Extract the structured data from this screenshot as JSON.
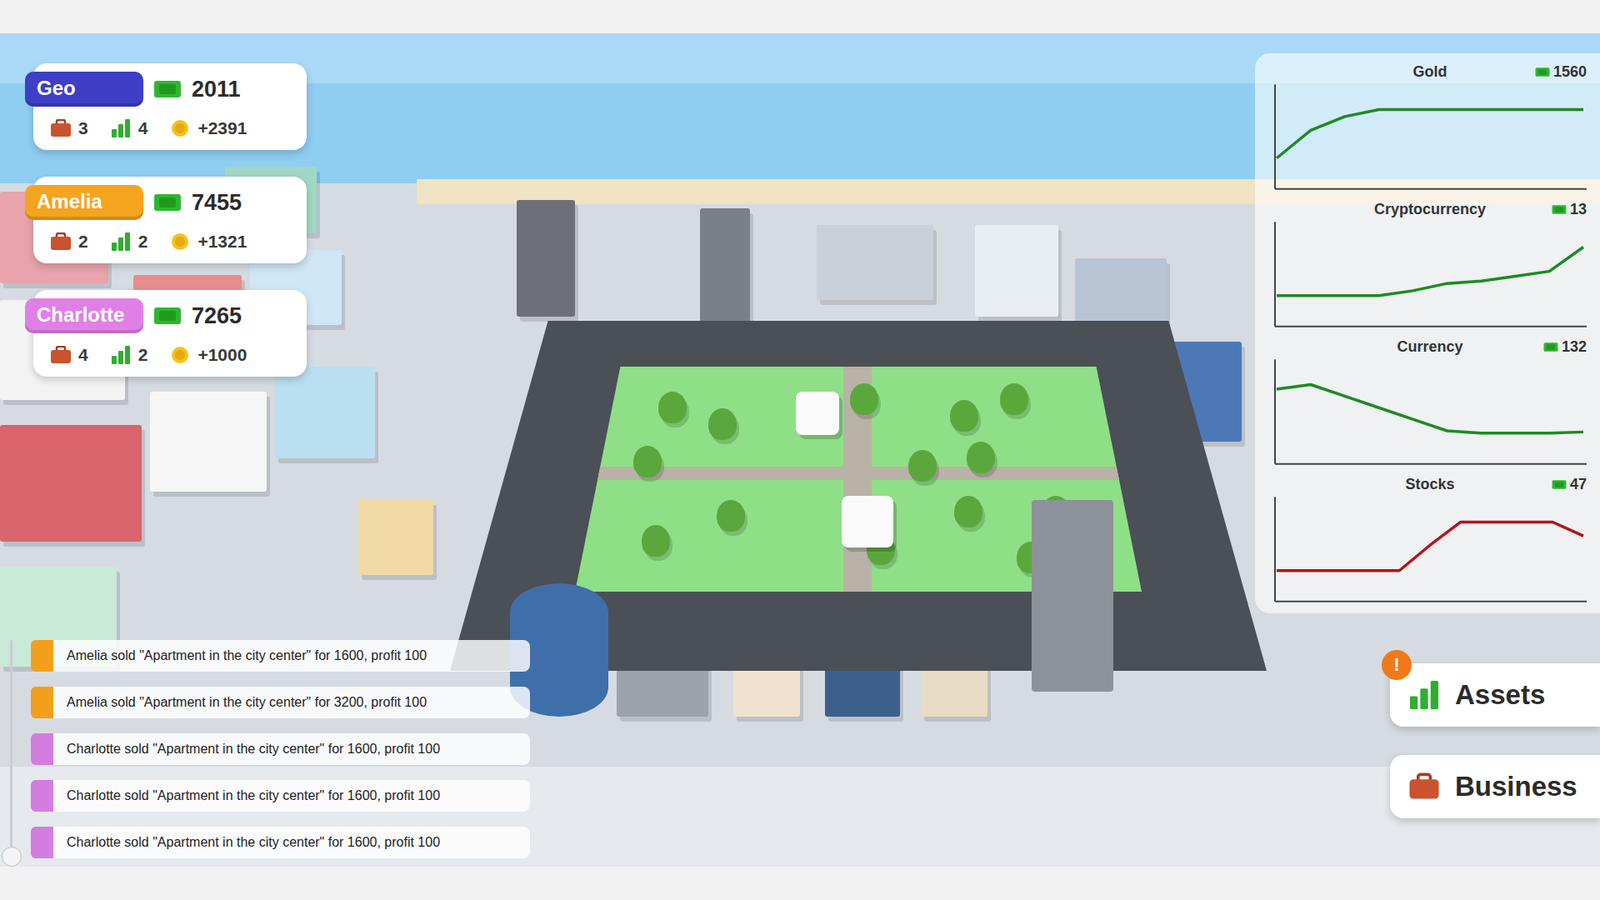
{
  "players": [
    {
      "name": "Geo",
      "color": "#3d3fc6",
      "money": "2011",
      "businesses": "3",
      "assets": "4",
      "income": "+2391"
    },
    {
      "name": "Amelia",
      "color": "#f4a41e",
      "money": "7455",
      "businesses": "2",
      "assets": "2",
      "income": "+1321"
    },
    {
      "name": "Charlotte",
      "color": "#e080e6",
      "money": "7265",
      "businesses": "4",
      "assets": "2",
      "income": "+1000"
    }
  ],
  "markets": [
    {
      "title": "Gold",
      "price": "1560",
      "color": "#1f8a22",
      "values": [
        1420,
        1500,
        1540,
        1560,
        1560,
        1560,
        1560,
        1560,
        1560,
        1560
      ]
    },
    {
      "title": "Cryptocurrency",
      "price": "13",
      "color": "#1f8a22",
      "values": [
        9,
        9,
        9,
        9,
        9.2,
        9.5,
        9.6,
        9.8,
        10,
        11
      ]
    },
    {
      "title": "Currency",
      "price": "132",
      "color": "#1f8a22",
      "values": [
        178,
        182,
        172,
        162,
        152,
        142,
        140,
        140,
        140,
        141
      ]
    },
    {
      "title": "Stocks",
      "price": "47",
      "color": "#b3141b",
      "values": [
        20,
        20,
        20,
        20,
        20,
        42,
        62,
        62,
        62,
        62,
        50
      ]
    }
  ],
  "log": [
    {
      "text": "Amelia sold \"Apartment in the city center\" for 1600, profit 100",
      "color": "#f2a01c"
    },
    {
      "text": "Amelia sold \"Apartment in the city center\" for 3200, profit 100",
      "color": "#f2a01c"
    },
    {
      "text": "Charlotte sold \"Apartment in the city center\" for 1600, profit 100",
      "color": "#d47de0"
    },
    {
      "text": "Charlotte sold \"Apartment in the city center\" for 1600, profit 100",
      "color": "#d47de0"
    },
    {
      "text": "Charlotte sold \"Apartment in the city center\" for 1600, profit 100",
      "color": "#d47de0"
    }
  ],
  "buttons": [
    {
      "label": "Assets",
      "badge": "!"
    },
    {
      "label": "Business"
    }
  ]
}
